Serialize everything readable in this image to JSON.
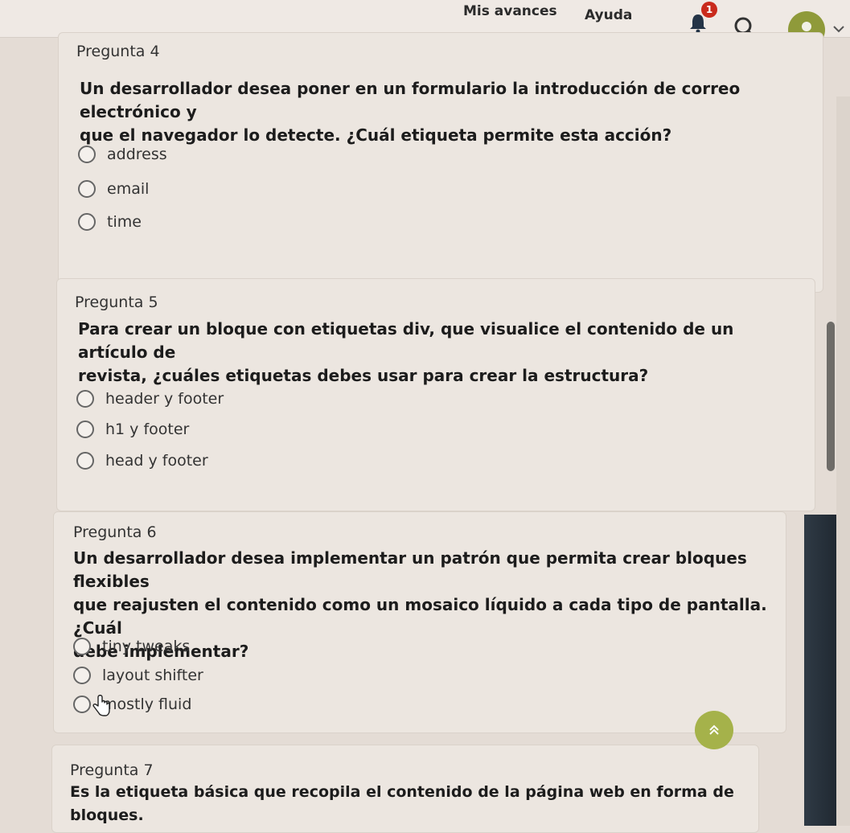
{
  "header": {
    "nav": [
      "Mis avances",
      "Ayuda"
    ],
    "notification_count": "1",
    "icons": {
      "bell": "bell-icon",
      "search": "search-icon",
      "avatar": "user-avatar-icon",
      "menu": "chevron-down-icon"
    },
    "accent_color": "#8f9a3a",
    "badge_color": "#c92a1c"
  },
  "questions": [
    {
      "number": "Pregunta 4",
      "text_lines": [
        "Un desarrollador desea poner en un formulario la introducción de correo electrónico y",
        "que el navegador lo detecte. ¿Cuál etiqueta permite esta acción?"
      ],
      "options": [
        "address",
        "email",
        "time"
      ]
    },
    {
      "number": "Pregunta 5",
      "text_lines": [
        "Para crear un bloque con etiquetas div, que visualice el contenido de un artículo de",
        "revista, ¿cuáles etiquetas debes usar para crear la estructura?"
      ],
      "options": [
        "header y footer",
        "h1 y footer",
        "head y footer"
      ]
    },
    {
      "number": "Pregunta 6",
      "text_lines": [
        "Un desarrollador desea implementar un patrón que permita crear bloques flexibles",
        "que reajusten el contenido como un mosaico líquido a cada tipo de pantalla. ¿Cuál",
        "debe implementar?"
      ],
      "options": [
        "tiny tweaks",
        "layout shifter",
        "mostly fluid"
      ]
    },
    {
      "number": "Pregunta 7",
      "text_lines": [
        "Es la etiqueta básica que recopila el contenido de la página web en forma de bloques."
      ],
      "options": []
    }
  ],
  "scroll_to_top_icon": "double-chevron-up-icon"
}
